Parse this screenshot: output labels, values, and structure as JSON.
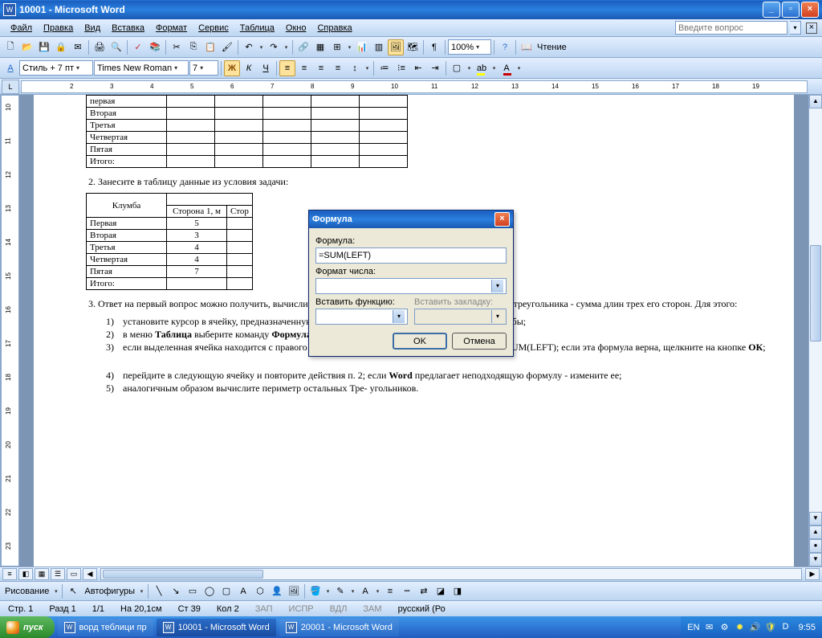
{
  "title": "10001 - Microsoft Word",
  "menus": [
    "Файл",
    "Правка",
    "Вид",
    "Вставка",
    "Формат",
    "Сервис",
    "Таблица",
    "Окно",
    "Справка"
  ],
  "ask_placeholder": "Введите вопрос",
  "style_combo": "Стиль + 7 пт",
  "font_combo": "Times New Roman",
  "size_combo": "7",
  "zoom": "100%",
  "reading": "Чтение",
  "ruler_h": [
    "2",
    "3",
    "4",
    "5",
    "6",
    "7",
    "8",
    "9",
    "10",
    "11",
    "12",
    "13",
    "14",
    "15",
    "16",
    "17",
    "18",
    "19"
  ],
  "ruler_v": [
    "10",
    "11",
    "12",
    "13",
    "14",
    "15",
    "16",
    "17",
    "18",
    "19",
    "20",
    "21",
    "22",
    "23"
  ],
  "table1_rows": [
    "первая",
    "Вторая",
    "Третья",
    "Четвертая",
    "Пятая",
    "Итого:"
  ],
  "doc_step2": "2. Занесите в таблицу данные из условия задачи:",
  "table2_header": [
    "Клумба",
    "Сторона 1, м",
    "Стор"
  ],
  "table2_rows": [
    [
      "Первая",
      "5",
      ""
    ],
    [
      "Вторая",
      "3",
      ""
    ],
    [
      "Третья",
      "4",
      ""
    ],
    [
      "Четвертая",
      "4",
      ""
    ],
    [
      "Пятая",
      "7",
      ""
    ],
    [
      "Итого:",
      "",
      ""
    ]
  ],
  "doc_step3": "3. Ответ на первый вопрос можно получить, вычислив значение в последней графе таблицы: периметр треугольника - сумма длин трех его сторон. Для этого:",
  "doc_list3": [
    "установите курсор в ячейку, предназначенную для занесения значения периметра первой клумбы;",
    "в меню Таблица выберите команду Формула;",
    "если выделенная ячейка находится с правого края строки чисел, Word предлагает формулу =SUM(LEFT); если эта формула верна, щелкните на кнопке ОК;",
    "перейдите в следующую ячейку и повторите действия п. 2; если Word предлагает неподходящую формулу - измените ее;",
    "аналогичным образом вычислите периметр остальных Тре- угольников."
  ],
  "dialog": {
    "title": "Формула",
    "formula_label": "Формула:",
    "formula_value": "=SUM(LEFT)",
    "numfmt_label": "Формат числа:",
    "insfunc_label": "Вставить функцию:",
    "insbook_label": "Вставить закладку:",
    "ok": "OK",
    "cancel": "Отмена"
  },
  "draw_label": "Рисование",
  "autoshapes": "Автофигуры",
  "status": {
    "page": "Стр. 1",
    "sect": "Разд 1",
    "pages": "1/1",
    "at": "На 20,1см",
    "line": "Ст 39",
    "col": "Кол 2",
    "rec": "ЗАП",
    "trk": "ИСПР",
    "ext": "ВДЛ",
    "ovr": "ЗАМ",
    "lang": "русский (Ро"
  },
  "start": "пуск",
  "tasks": [
    {
      "icon": "W",
      "label": "ворд теблици пр"
    },
    {
      "icon": "W",
      "label": "10001 - Microsoft Word"
    },
    {
      "icon": "W",
      "label": "20001 - Microsoft Word"
    }
  ],
  "tray_lang": "EN",
  "clock": "9:55"
}
